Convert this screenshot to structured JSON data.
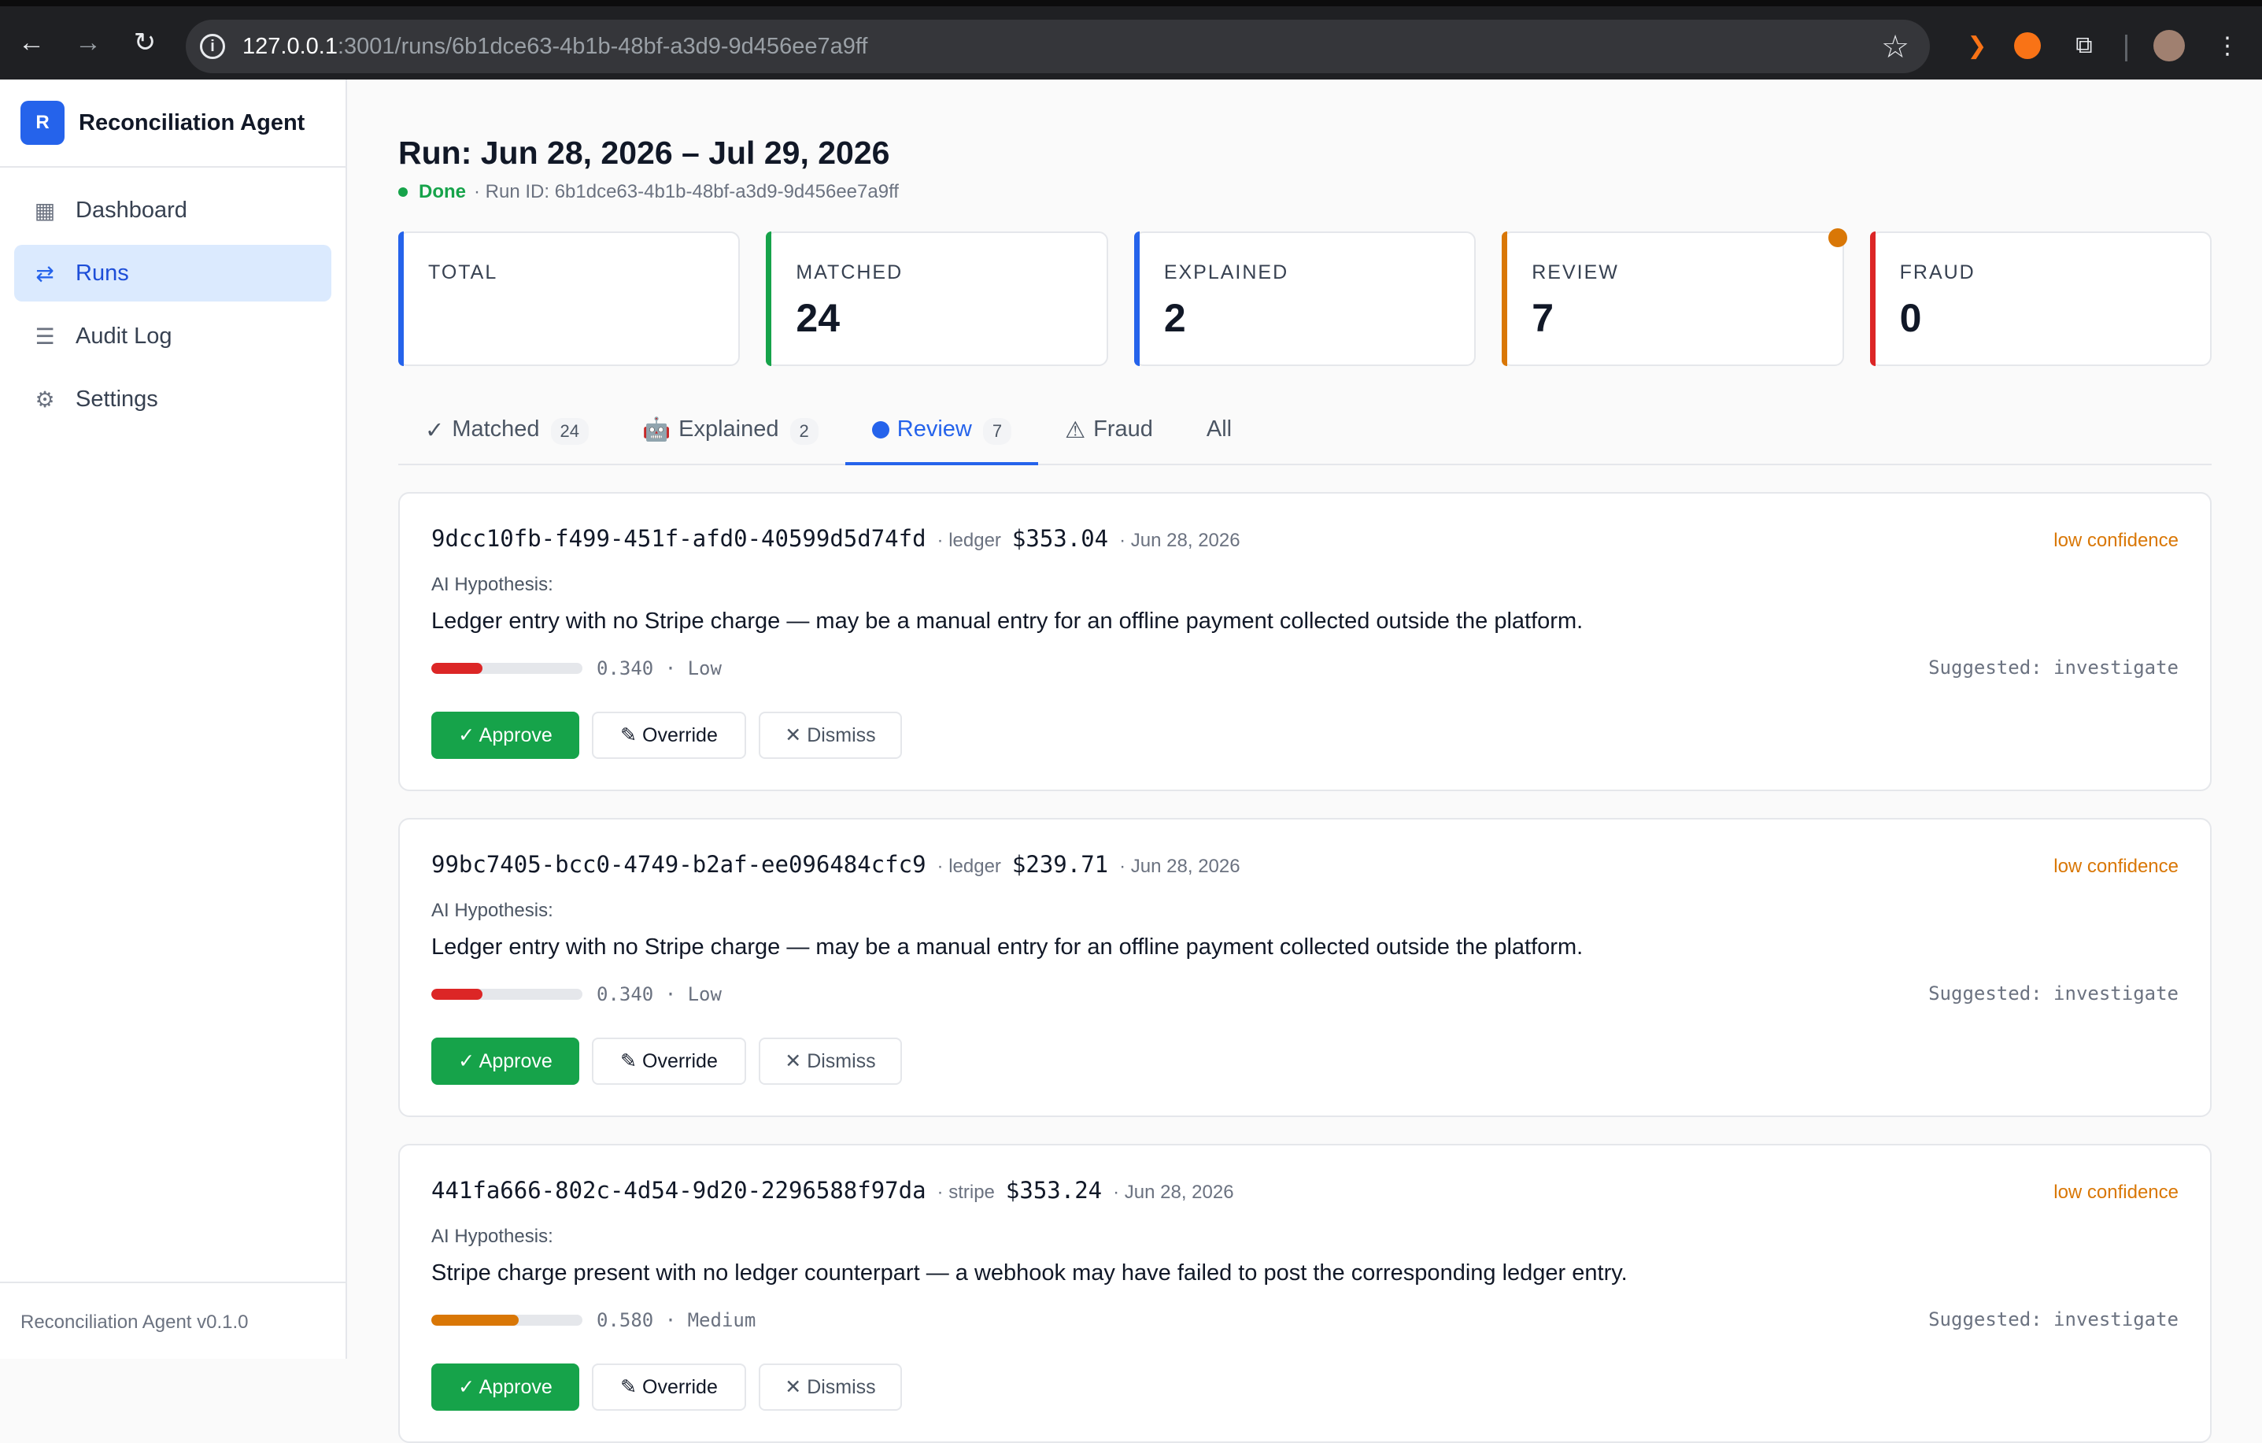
{
  "browser": {
    "url_host": "127.0.0.1",
    "url_rest": ":3001/runs/6b1dce63-4b1b-48bf-a3d9-9d456ee7a9ff"
  },
  "sidebar": {
    "brand_letter": "R",
    "brand_name": "Reconciliation Agent",
    "items": [
      {
        "label": "Dashboard",
        "icon": "dashboard-icon"
      },
      {
        "label": "Runs",
        "icon": "runs-icon"
      },
      {
        "label": "Audit Log",
        "icon": "audit-log-icon"
      },
      {
        "label": "Settings",
        "icon": "gear-icon"
      }
    ],
    "version": "Reconciliation Agent v0.1.0"
  },
  "run": {
    "title": "Run: Jun 28, 2026 – Jul 29, 2026",
    "status": "Done",
    "run_id": "· Run ID: 6b1dce63-4b1b-48bf-a3d9-9d456ee7a9ff"
  },
  "stats": [
    {
      "label": "TOTAL",
      "value": "",
      "color": "#2563eb"
    },
    {
      "label": "MATCHED",
      "value": "24",
      "color": "#16a34a"
    },
    {
      "label": "EXPLAINED",
      "value": "2",
      "color": "#2563eb"
    },
    {
      "label": "REVIEW",
      "value": "7",
      "color": "#d97706"
    },
    {
      "label": "FRAUD",
      "value": "0",
      "color": "#dc2626"
    }
  ],
  "tabs": [
    {
      "label": "Matched",
      "count": "24",
      "icon": "✓"
    },
    {
      "label": "Explained",
      "count": "2",
      "icon": "🤖"
    },
    {
      "label": "Review",
      "count": "7",
      "icon": "blue-dot"
    },
    {
      "label": "Fraud",
      "count": "",
      "icon": "⚠"
    },
    {
      "label": "All",
      "count": "",
      "icon": ""
    }
  ],
  "cards": [
    {
      "id": "9dcc10fb-f499-451f-afd0-40599d5d74fd",
      "source": "· ledger",
      "amount": "$353.04",
      "date": "· Jun 28, 2026",
      "confidence": "low confidence",
      "hyp_label": "AI Hypothesis:",
      "hypothesis": "Ledger entry with no Stripe charge — may be a manual entry for an offline payment collected outside the platform.",
      "score": "0.340 · Low",
      "score_value": 0.34,
      "score_color": "#dc2626",
      "suggested": "Suggested: investigate"
    },
    {
      "id": "99bc7405-bcc0-4749-b2af-ee096484cfc9",
      "source": "· ledger",
      "amount": "$239.71",
      "date": "· Jun 28, 2026",
      "confidence": "low confidence",
      "hyp_label": "AI Hypothesis:",
      "hypothesis": "Ledger entry with no Stripe charge — may be a manual entry for an offline payment collected outside the platform.",
      "score": "0.340 · Low",
      "score_value": 0.34,
      "score_color": "#dc2626",
      "suggested": "Suggested: investigate"
    },
    {
      "id": "441fa666-802c-4d54-9d20-2296588f97da",
      "source": "· stripe",
      "amount": "$353.24",
      "date": "· Jun 28, 2026",
      "confidence": "low confidence",
      "hyp_label": "AI Hypothesis:",
      "hypothesis": "Stripe charge present with no ledger counterpart — a webhook may have failed to post the corresponding ledger entry.",
      "score": "0.580 · Medium",
      "score_value": 0.58,
      "score_color": "#d97706",
      "suggested": "Suggested: investigate"
    }
  ],
  "actions": {
    "approve": "✓ Approve",
    "override": "✎ Override",
    "dismiss": "✕ Dismiss"
  }
}
